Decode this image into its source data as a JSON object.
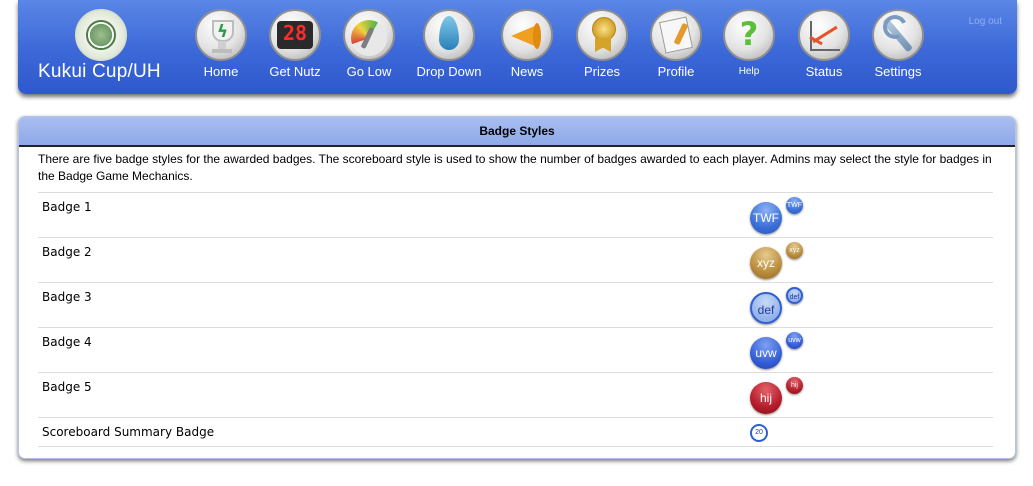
{
  "header": {
    "brand": "Kukui Cup/UH",
    "logout": "Log out",
    "nav": [
      {
        "label": "Home",
        "icon": "trophy-icon"
      },
      {
        "label": "Get Nutz",
        "icon": "scoreboard-icon",
        "icon_text": "28"
      },
      {
        "label": "Go Low",
        "icon": "gauge-icon"
      },
      {
        "label": "Drop Down",
        "icon": "water-drop-icon"
      },
      {
        "label": "News",
        "icon": "megaphone-icon"
      },
      {
        "label": "Prizes",
        "icon": "medal-icon"
      },
      {
        "label": "Profile",
        "icon": "profile-card-icon"
      },
      {
        "label": "Help",
        "icon": "question-mark-icon"
      },
      {
        "label": "Status",
        "icon": "line-chart-icon"
      },
      {
        "label": "Settings",
        "icon": "wrench-icon"
      }
    ]
  },
  "panel": {
    "title": "Badge Styles",
    "description": "There are five badge styles for the awarded badges. The scoreboard style is used to show the number of badges awarded to each player. Admins may select the style for badges in the Badge Game Mechanics.",
    "rows": [
      {
        "label": "Badge 1",
        "large": "TWF",
        "small": "TWF"
      },
      {
        "label": "Badge 2",
        "large": "xyz",
        "small": "xyz"
      },
      {
        "label": "Badge 3",
        "large": "def",
        "small": "def"
      },
      {
        "label": "Badge 4",
        "large": "uvw",
        "small": "uvw"
      },
      {
        "label": "Badge 5",
        "large": "hij",
        "small": "hij"
      },
      {
        "label": "Scoreboard Summary Badge",
        "score": "20"
      }
    ]
  },
  "colors": {
    "header_blue": "#3c68d8",
    "panel_title_blue": "#8ea9e8",
    "badge_1": "#3b6fd8",
    "badge_2": "#b98d3d",
    "badge_3": "#93b1ec",
    "badge_4": "#3660d8",
    "badge_5": "#b51d2b"
  }
}
